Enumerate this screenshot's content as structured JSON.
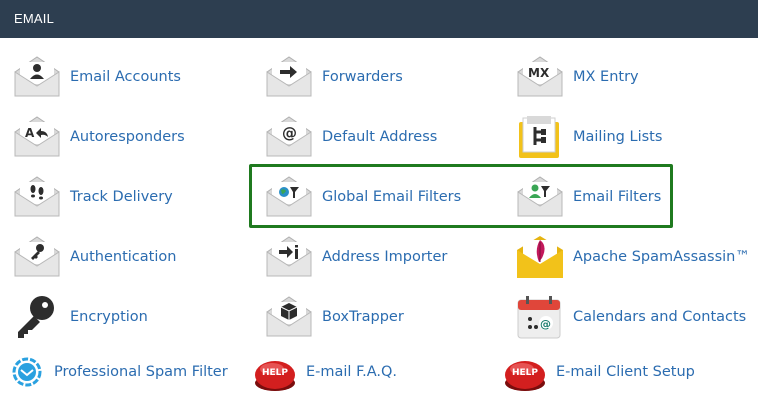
{
  "section": {
    "title": "EMAIL"
  },
  "items": {
    "email_accounts": "Email Accounts",
    "forwarders": "Forwarders",
    "mx_entry": "MX Entry",
    "autoresponders": "Autoresponders",
    "default_address": "Default Address",
    "mailing_lists": "Mailing Lists",
    "track_delivery": "Track Delivery",
    "global_email_filters": "Global Email Filters",
    "email_filters": "Email Filters",
    "authentication": "Authentication",
    "address_importer": "Address Importer",
    "apache_spamassassin": "Apache SpamAssassin™",
    "encryption": "Encryption",
    "boxtrapper": "BoxTrapper",
    "calendars_and_contacts": "Calendars and Contacts",
    "professional_spam_filter": "Professional Spam Filter",
    "email_faq": "E-mail F.A.Q.",
    "email_client_setup": "E-mail Client Setup"
  },
  "icon_text": {
    "mx": "MX",
    "help": "HELP"
  },
  "icons": {
    "email_accounts": "envelope-user-icon",
    "forwarders": "envelope-arrow-icon",
    "mx_entry": "envelope-mx-icon",
    "autoresponders": "envelope-reply-icon",
    "default_address": "envelope-at-icon",
    "mailing_lists": "mailing-list-icon",
    "track_delivery": "envelope-footprints-icon",
    "global_email_filters": "envelope-globe-filter-icon",
    "email_filters": "envelope-user-filter-icon",
    "authentication": "envelope-key-icon",
    "address_importer": "envelope-import-icon",
    "apache_spamassassin": "envelope-feather-icon",
    "encryption": "key-icon",
    "boxtrapper": "envelope-box-icon",
    "calendars_and_contacts": "calendar-icon",
    "professional_spam_filter": "spam-filter-icon",
    "email_faq": "help-button-icon",
    "email_client_setup": "help-button-icon"
  },
  "colors": {
    "header_bg": "#2d3e50",
    "link": "#2b6cb0",
    "highlight_border": "#1f7a1f"
  }
}
